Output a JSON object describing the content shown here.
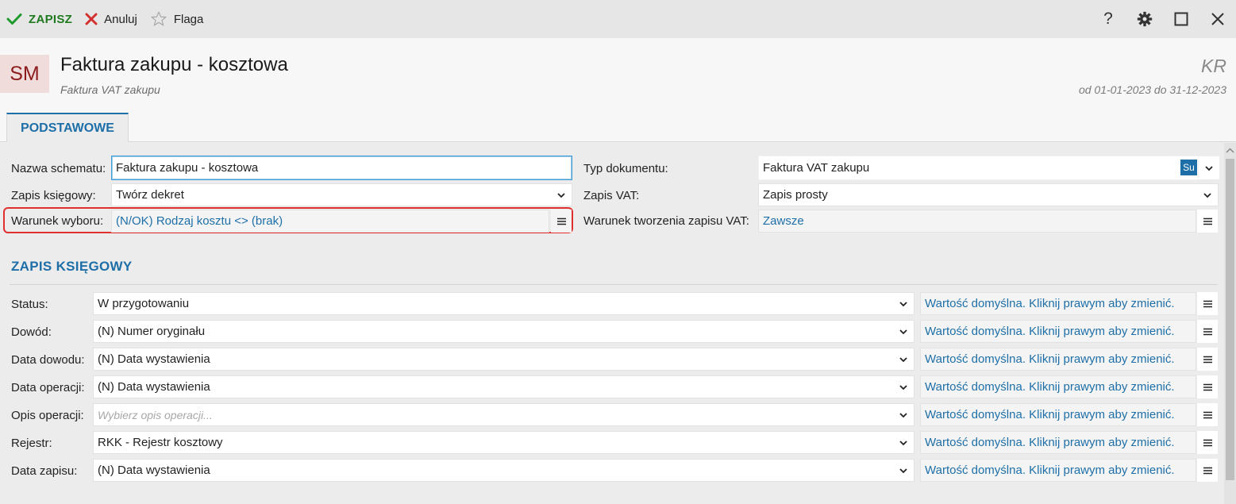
{
  "toolbar": {
    "save_label": "ZAPISZ",
    "cancel_label": "Anuluj",
    "flag_label": "Flaga",
    "help_label": "?"
  },
  "header": {
    "avatar": "SM",
    "title": "Faktura zakupu - kosztowa",
    "subtitle": "Faktura VAT zakupu",
    "code": "KR",
    "period": "od 01-01-2023 do 31-12-2023"
  },
  "tabs": [
    {
      "label": "PODSTAWOWE",
      "active": true
    }
  ],
  "basic": {
    "name_label": "Nazwa schematu:",
    "name_value": "Faktura zakupu - kosztowa",
    "entry_label": "Zapis księgowy:",
    "entry_value": "Twórz dekret",
    "condition_label": "Warunek wyboru:",
    "condition_value": "(N/OK) Rodzaj kosztu <> (brak)",
    "doc_type_label": "Typ dokumentu:",
    "doc_type_value": "Faktura VAT zakupu",
    "doc_type_badge": "Su",
    "vat_label": "Zapis VAT:",
    "vat_value": "Zapis prosty",
    "vat_condition_label": "Warunek tworzenia zapisu VAT:",
    "vat_condition_value": "Zawsze"
  },
  "section_title": "ZAPIS KSIĘGOWY",
  "entry_rows": [
    {
      "label": "Status:",
      "value": "W przygotowaniu",
      "placeholder": false,
      "default_text": "Wartość domyślna. Kliknij prawym aby zmienić."
    },
    {
      "label": "Dowód:",
      "value": "(N) Numer oryginału",
      "placeholder": false,
      "default_text": "Wartość domyślna. Kliknij prawym aby zmienić."
    },
    {
      "label": "Data dowodu:",
      "value": "(N) Data wystawienia",
      "placeholder": false,
      "default_text": "Wartość domyślna. Kliknij prawym aby zmienić."
    },
    {
      "label": "Data operacji:",
      "value": "(N) Data wystawienia",
      "placeholder": false,
      "default_text": "Wartość domyślna. Kliknij prawym aby zmienić."
    },
    {
      "label": "Opis operacji:",
      "value": "Wybierz opis operacji...",
      "placeholder": true,
      "default_text": "Wartość domyślna. Kliknij prawym aby zmienić."
    },
    {
      "label": "Rejestr:",
      "value": "RKK - Rejestr kosztowy",
      "placeholder": false,
      "default_text": "Wartość domyślna. Kliknij prawym aby zmienić."
    },
    {
      "label": "Data zapisu:",
      "value": "(N) Data wystawienia",
      "placeholder": false,
      "default_text": "Wartość domyślna. Kliknij prawym aby zmienić."
    }
  ],
  "colors": {
    "accent": "#1e6fa8",
    "save": "#1f7a1f",
    "cancel": "#d32f2f",
    "highlight": "#e0302e",
    "avatar_bg": "#f1dcdc",
    "avatar_fg": "#8b1c1c"
  },
  "icons": {
    "save": "check-icon",
    "cancel": "x-icon",
    "flag": "star-outline-icon",
    "help": "help-icon",
    "settings": "gear-icon",
    "maximize": "maximize-icon",
    "close": "close-icon",
    "dropdown": "chevron-down-icon",
    "menu": "hamburger-icon"
  }
}
